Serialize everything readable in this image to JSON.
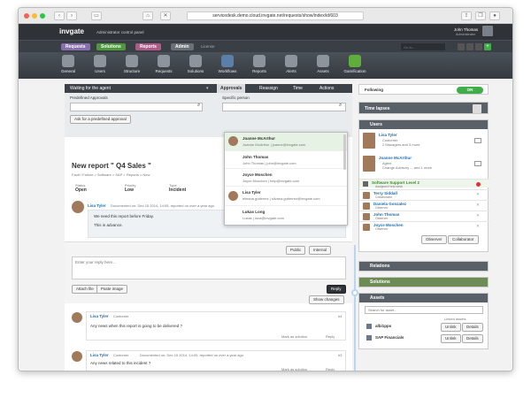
{
  "browser": {
    "url": "servicedesk.demo.cloud.invgate.net/requests/show/index/id/603"
  },
  "app": {
    "logo": "invgate",
    "subtitle": "Administrator control panel",
    "user": "John Thomas",
    "user_role": "Administrator",
    "goto_placeholder": "Go to..."
  },
  "menu": {
    "requests": "Requests",
    "solutions": "Solutions",
    "reports": "Reports",
    "admin": "Admin",
    "license": "License"
  },
  "toolbar": [
    "General",
    "Users",
    "Structure",
    "Requests",
    "Solutions",
    "Workflows",
    "Reports",
    "Alerts",
    "Assets",
    "Gamification"
  ],
  "request": {
    "status_bar": "Waiting for the agent",
    "tabs": {
      "approvals": "Approvals",
      "reassign": "Reassign",
      "time": "Time",
      "actions": "Actions"
    },
    "predef_label": "Predefined Approvals",
    "specific_label": "Specific person",
    "ask_button": "Ask for a predefined approval",
    "title": "New report \" Q4 Sales \"",
    "breadcrumb": "Fault / Failure > Software > SAP > Reports > New",
    "meta": [
      {
        "k": "Status",
        "v": "Open"
      },
      {
        "k": "Priority",
        "v": "Low"
      },
      {
        "k": "Type",
        "v": "Incident"
      }
    ],
    "author": "Lisa Tyler",
    "documented": "Documented on: Dec 15 2014, 14:05, reported on over a year ago",
    "messages": [
      "We need this report before Friday.",
      "This in advance."
    ],
    "reply_tabs": {
      "public": "Public",
      "internal": "Internal"
    },
    "reply_placeholder": "Enter your reply here...",
    "attach": "Attach file",
    "paste": "Paste image",
    "reply": "Reply",
    "show_changes": "Show changes",
    "comments": [
      {
        "name": "Lisa Tyler",
        "role": "Customer",
        "num": "#4",
        "text": "Any news when this report is going to be delivered ?",
        "mark": "Mark as solution",
        "reply": "Reply"
      },
      {
        "name": "Lisa Tyler",
        "role": "Customer",
        "num": "#3",
        "text": "Any news related to this incident ?",
        "mark": "Mark as solution",
        "reply": "Reply",
        "documented": "Documented on: Dec 15 2014, 14:05, reported on over a year ago"
      }
    ]
  },
  "dropdown": [
    {
      "name": "Joanne McArthur",
      "sub": "Joanne McArthur | joanne@invgate.com"
    },
    {
      "name": "John Thomas",
      "sub": "John Thomas | john@invgate.com"
    },
    {
      "name": "Joyce Moschen",
      "sub": "Joyce Moschen | help@invgate.com"
    },
    {
      "name": "Lisa Tyler",
      "sub": "elinana.gutierrez | silvana.gutierrez@invgate.com"
    },
    {
      "name": "Lukas Long",
      "sub": "Lukas | luca@invgate.com"
    }
  ],
  "sidebar": {
    "following": "Following",
    "on": "ON",
    "time_lapses": "Time lapses",
    "users": "Users",
    "users_list": [
      {
        "name": "Lisa Tyler",
        "role": "Customer",
        "sub": "2 Managers and 3 more"
      },
      {
        "name": "Joanne McArthur",
        "role": "Agent",
        "sub": "Change Advisory ... and 1 more"
      }
    ],
    "group": "Software Support Level 2",
    "group_sub": "Assigned Help desk",
    "observers": [
      {
        "name": "Terry Siddall",
        "role": "Collaborator"
      },
      {
        "name": "Daniela Gonzalez",
        "role": "Observer"
      },
      {
        "name": "John Thomas",
        "role": "Observer"
      },
      {
        "name": "Joyce Moschen",
        "role": "Observer"
      }
    ],
    "observer_btn": "Observer",
    "collaborator_btn": "Collaborator",
    "relations": "Relations",
    "solutions": "Solutions",
    "assets": "Assets",
    "asset_placeholder": "Search for asset...",
    "linked": "Linked assets",
    "assets_list": [
      {
        "name": "albi1pps",
        "unlink": "Unlink",
        "details": "Details"
      },
      {
        "name": "SAP Financials",
        "unlink": "Unlink",
        "details": "Details"
      }
    ]
  },
  "colors": {
    "accent_green": "#3fae49",
    "header_dark": "#2f3338",
    "requests_pill": "#8a6fb0",
    "solutions_pill": "#4d9a3c",
    "reports_pill": "#b05a8a",
    "admin_pill": "#6b6f76"
  }
}
